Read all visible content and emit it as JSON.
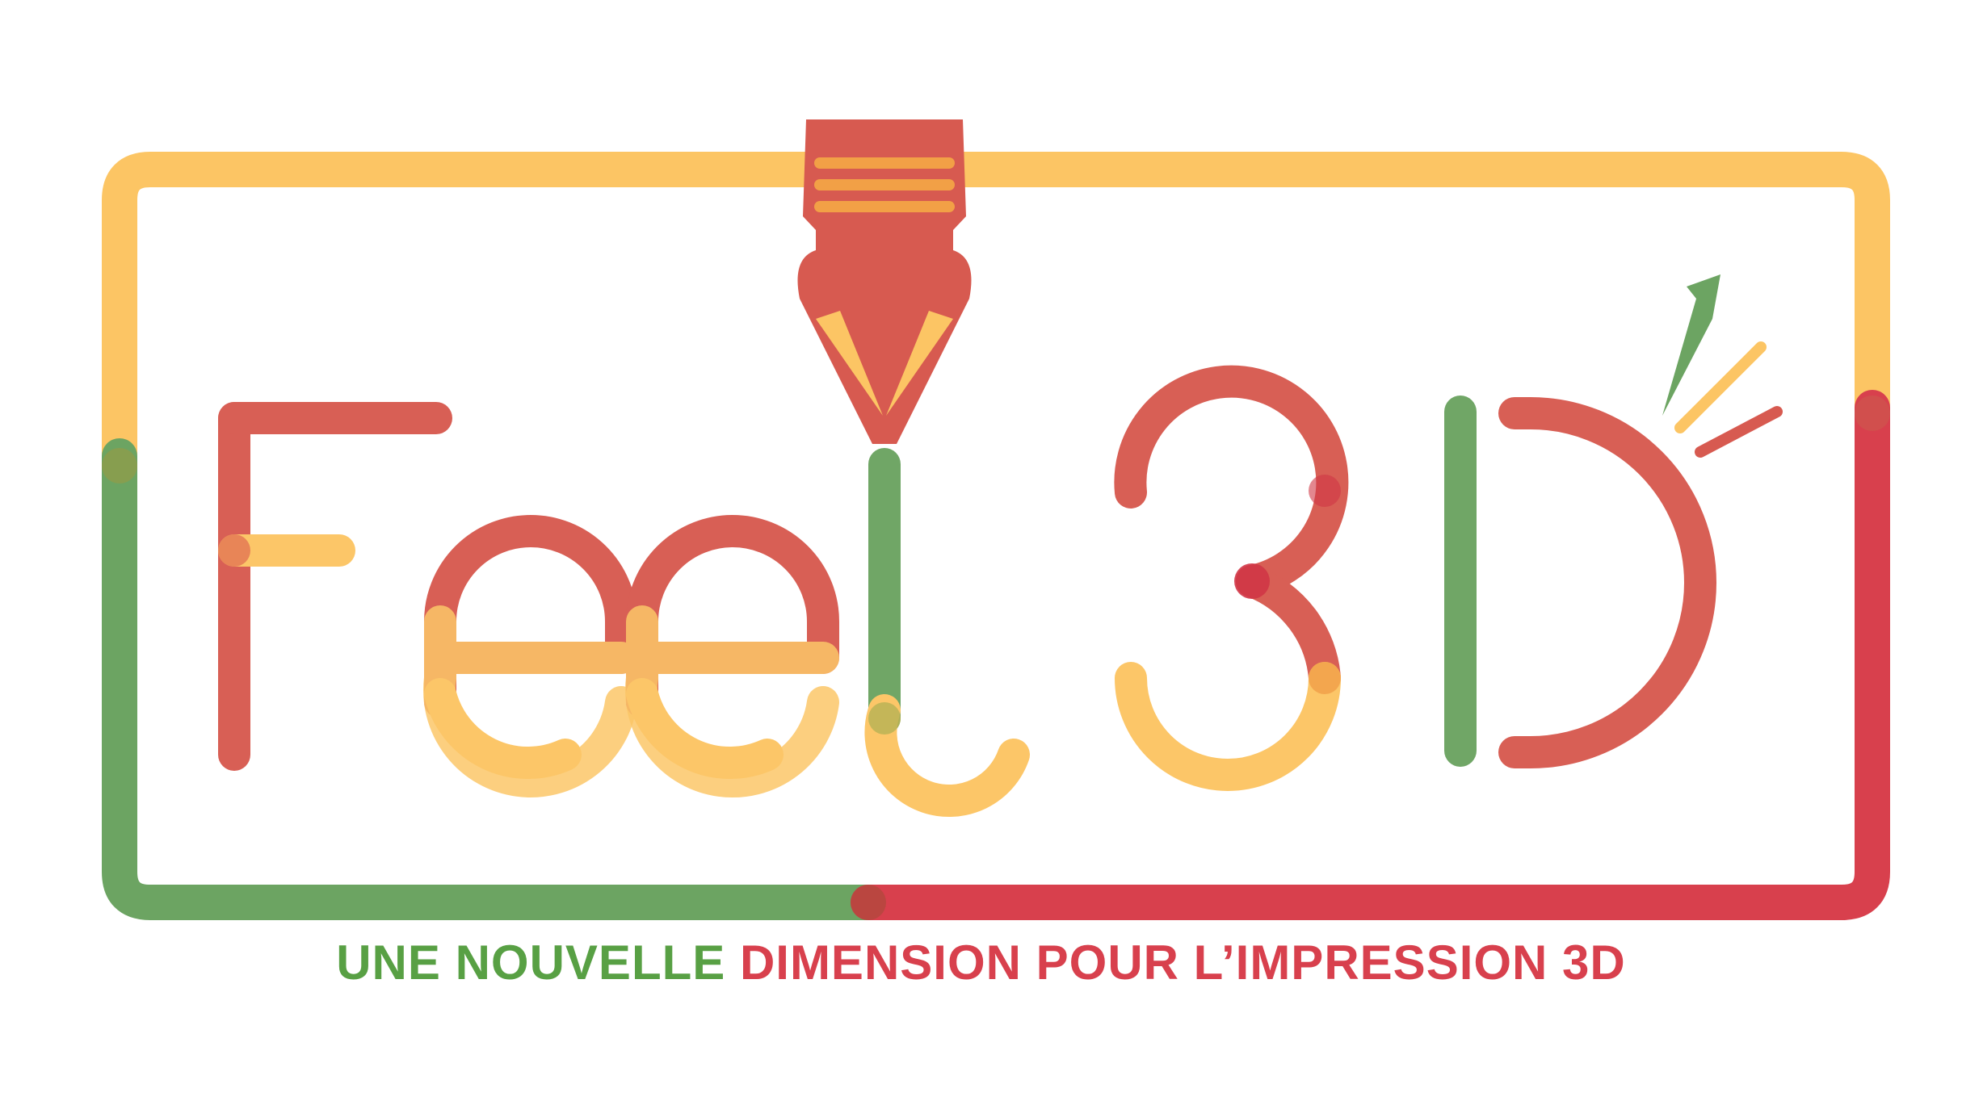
{
  "logo": {
    "wordmark": "Feel3D",
    "tagline_part_green": "UNE NOUVELLE",
    "tagline_part_red": "DIMENSION POUR L’IMPRESSION 3D"
  },
  "colors": {
    "yellow": "#fcc564",
    "red": "#d75a50",
    "deep_red": "#d8404d",
    "green": "#6ca462",
    "orange": "#f2a046",
    "tagline_green": "#58a044",
    "tagline_red": "#d8404d"
  },
  "icons": [
    "printer-nozzle-icon",
    "spark-lines-icon"
  ]
}
